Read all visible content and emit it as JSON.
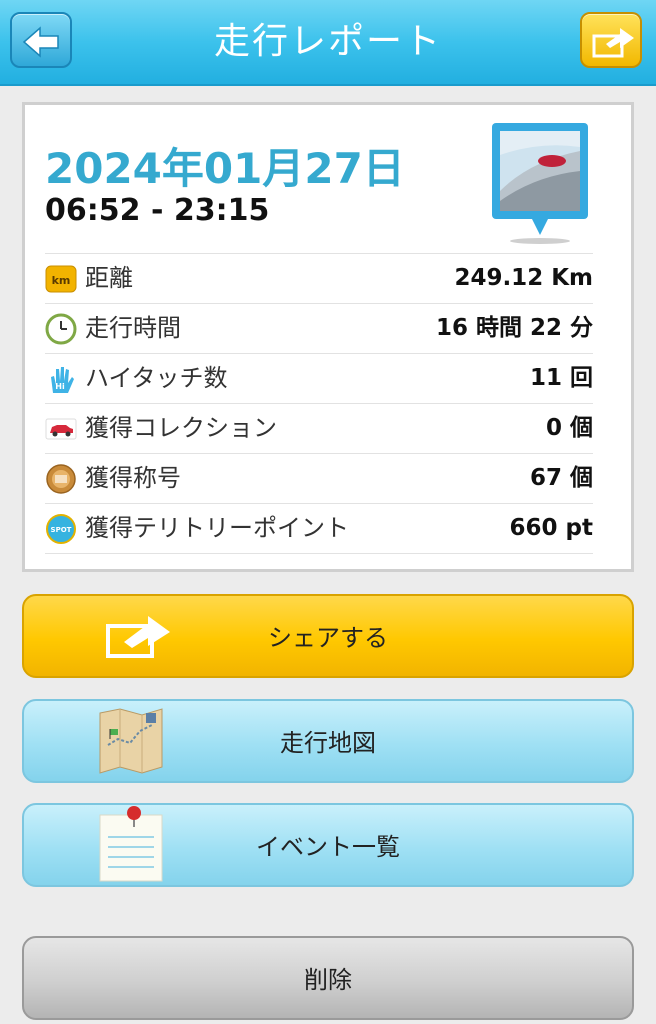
{
  "header": {
    "title": "走行レポート",
    "back_icon": "arrow-left-icon",
    "share_icon": "share-arrow-icon"
  },
  "report": {
    "date": "2024年01月27日",
    "time_range": "06:52 - 23:15",
    "stats": [
      {
        "icon": "km-icon",
        "label": "距離",
        "value": "249.12 Km"
      },
      {
        "icon": "clock-icon",
        "label": "走行時間",
        "value": "16 時間 22 分"
      },
      {
        "icon": "hi-touch-hand-icon",
        "label": "ハイタッチ数",
        "value": "11 回"
      },
      {
        "icon": "car-collection-icon",
        "label": "獲得コレクション",
        "value": "0 個"
      },
      {
        "icon": "title-medal-icon",
        "label": "獲得称号",
        "value": "67 個"
      },
      {
        "icon": "spot-icon",
        "label": "獲得テリトリーポイント",
        "value": "660 pt"
      }
    ]
  },
  "actions": {
    "share": "シェアする",
    "map": "走行地図",
    "events": "イベント一覧",
    "delete": "削除"
  },
  "colors": {
    "header": "#3cc2ec",
    "date": "#35a9cf",
    "share_button": "#ffc800",
    "light_button": "#9fe0f4",
    "delete_button": "#cfcfcf"
  }
}
